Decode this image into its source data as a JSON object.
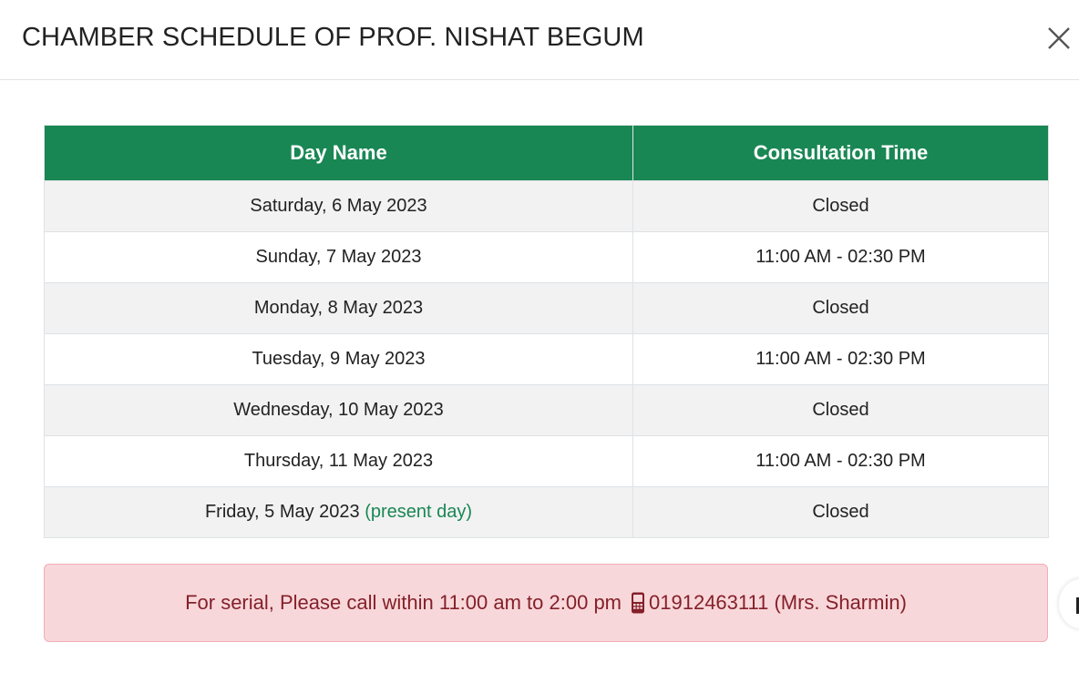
{
  "modal": {
    "title": "CHAMBER SCHEDULE OF PROF. NISHAT BEGUM",
    "close_icon": "close-icon"
  },
  "table": {
    "headers": [
      "Day Name",
      "Consultation Time"
    ],
    "rows": [
      {
        "day": "Saturday, 6 May 2023",
        "time": "Closed",
        "status": "closed"
      },
      {
        "day": "Sunday, 7 May 2023",
        "time": "11:00 AM - 02:30 PM",
        "status": "open"
      },
      {
        "day": "Monday, 8 May 2023",
        "time": "Closed",
        "status": "closed"
      },
      {
        "day": "Tuesday, 9 May 2023",
        "time": "11:00 AM - 02:30 PM",
        "status": "open"
      },
      {
        "day": "Wednesday, 10 May 2023",
        "time": "Closed",
        "status": "closed"
      },
      {
        "day": "Thursday, 11 May 2023",
        "time": "11:00 AM - 02:30 PM",
        "status": "open"
      },
      {
        "day": "Friday, 5 May 2023",
        "day_note": "(present day)",
        "time": "Closed",
        "status": "closed"
      }
    ]
  },
  "alert": {
    "text": "For serial, Please call within 11:00 am to 2:00 pm",
    "phone_icon": "mobile-phone-icon",
    "phone": "01912463111 (Mrs. Sharmin)"
  },
  "colors": {
    "header_green": "#198754",
    "closed_red": "#dc3545",
    "alert_bg": "#f8d7da",
    "alert_text": "#842029"
  }
}
